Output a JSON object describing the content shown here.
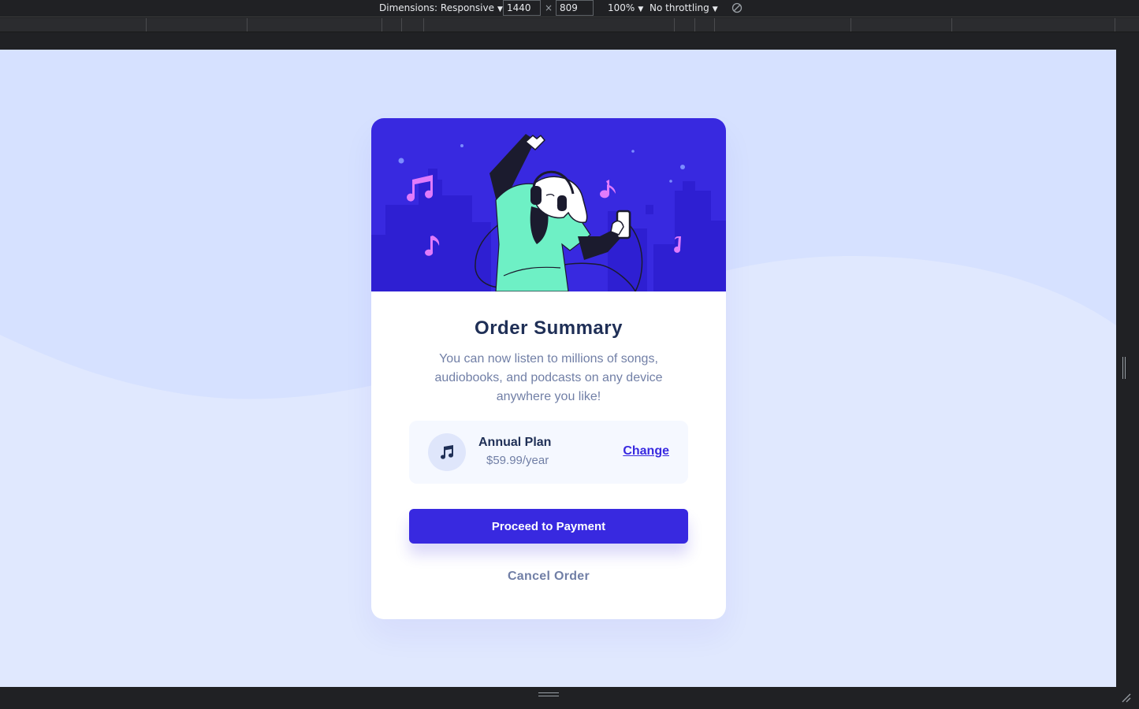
{
  "devtools": {
    "dimensions_label": "Dimensions: Responsive",
    "width_value": "1440",
    "times_symbol": "×",
    "height_value": "809",
    "zoom_label": "100%",
    "throttling_label": "No throttling",
    "icons": [
      "chevron-down-icon",
      "rotate-icon",
      "resize-grip-icon"
    ]
  },
  "card": {
    "title": "Order Summary",
    "description": "You can now listen to millions of songs, audiobooks, and podcasts on any device anywhere you like!",
    "plan": {
      "name": "Annual Plan",
      "price": "$59.99/year",
      "change_label": "Change",
      "icon": "music-note-icon"
    },
    "proceed_label": "Proceed to Payment",
    "cancel_label": "Cancel Order"
  },
  "colors": {
    "page_background": "#e0e8fe",
    "wave": "#d6e1ff",
    "hero_background": "#3829e0",
    "accent": "#3829e0",
    "title": "#1f2f56",
    "muted_text": "#717fa6",
    "plan_background": "#f5f8ff"
  }
}
